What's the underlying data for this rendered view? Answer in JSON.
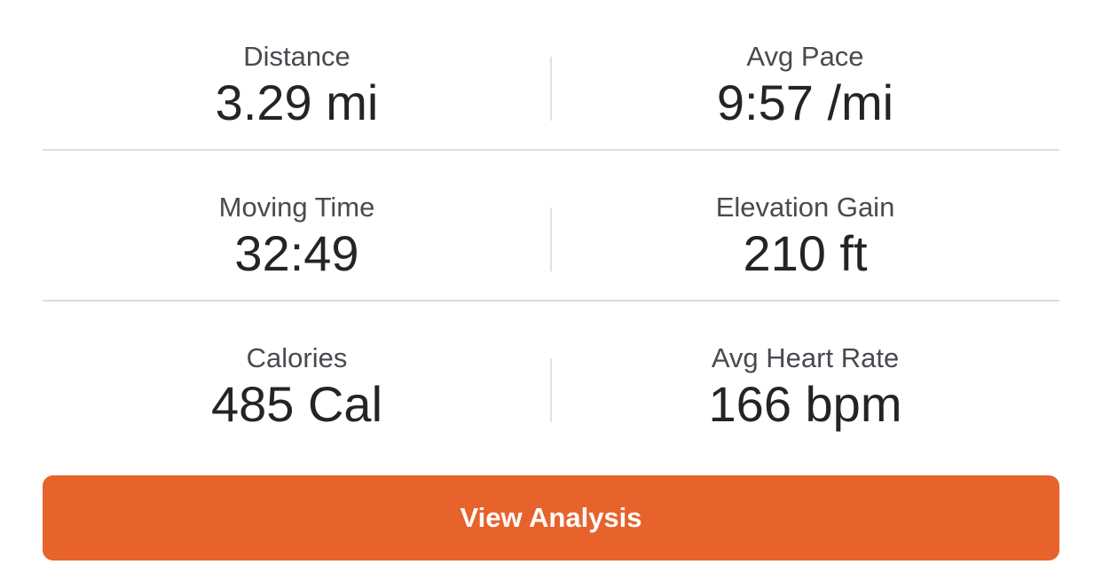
{
  "stats": [
    [
      {
        "label": "Distance",
        "value": "3.29 mi"
      },
      {
        "label": "Avg Pace",
        "value": "9:57 /mi"
      }
    ],
    [
      {
        "label": "Moving Time",
        "value": "32:49"
      },
      {
        "label": "Elevation Gain",
        "value": "210 ft"
      }
    ],
    [
      {
        "label": "Calories",
        "value": "485 Cal"
      },
      {
        "label": "Avg Heart Rate",
        "value": "166 bpm"
      }
    ]
  ],
  "cta": {
    "label": "View Analysis",
    "color": "#e8622c"
  }
}
